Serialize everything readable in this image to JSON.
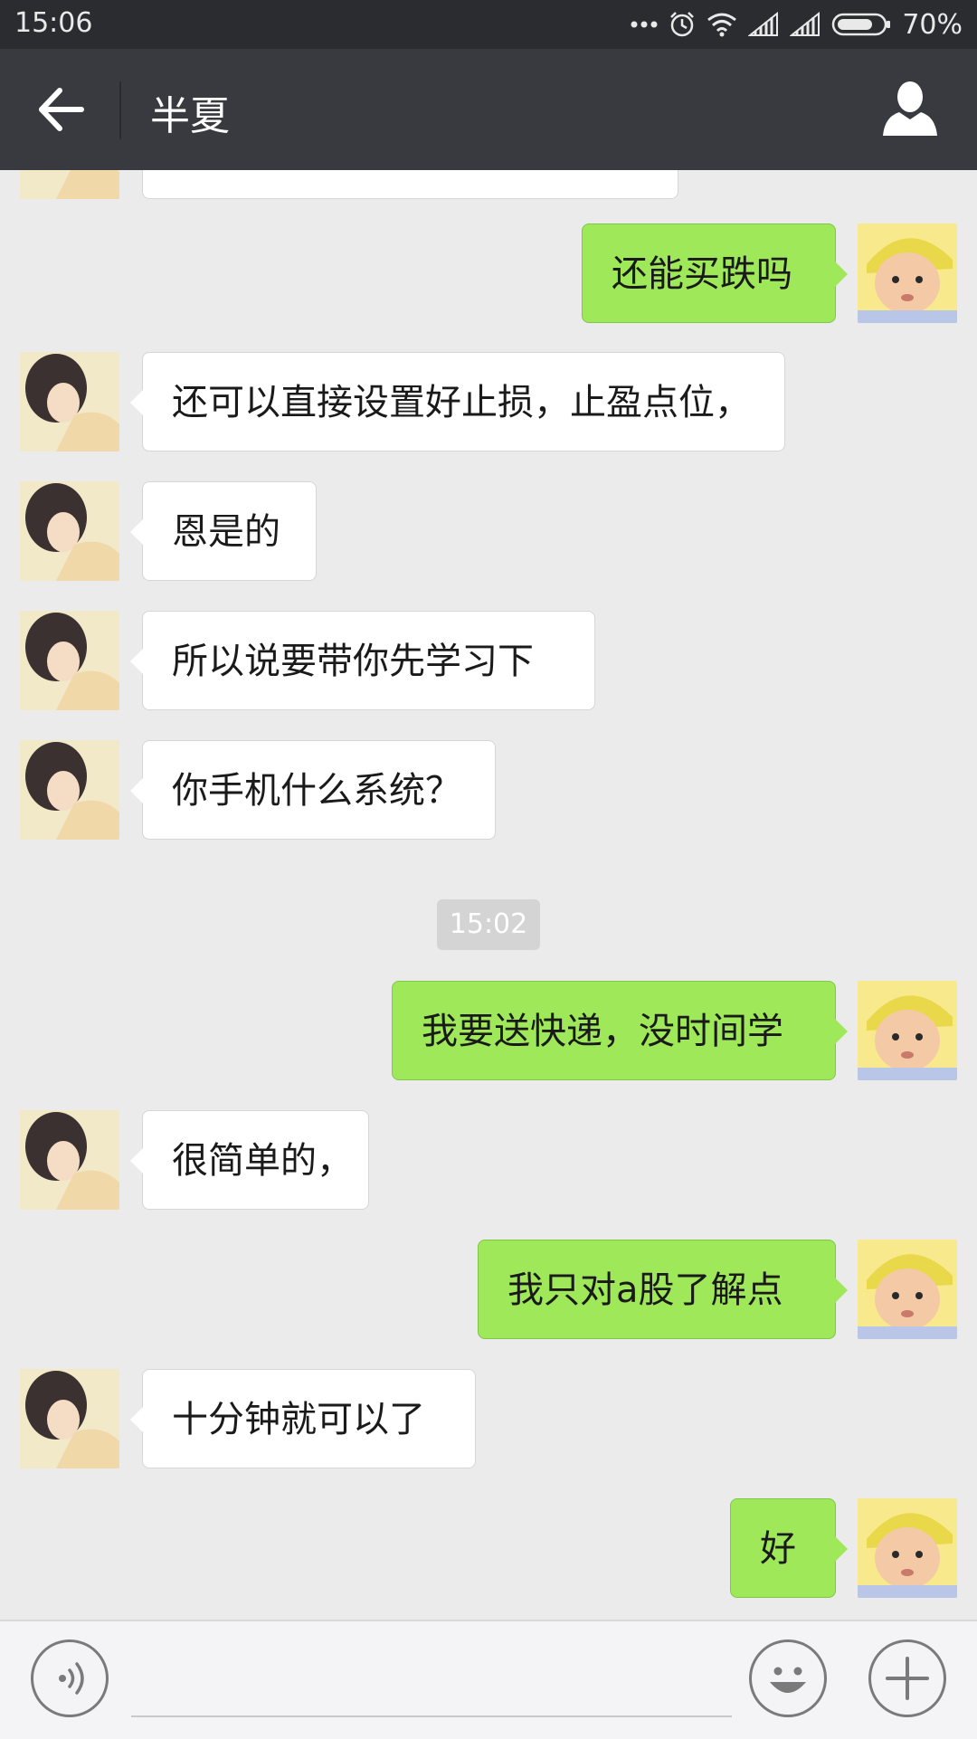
{
  "status_bar": {
    "time": "15:06",
    "battery_percent": "70%",
    "icons": [
      "more-dots-icon",
      "alarm-icon",
      "wifi-icon",
      "signal-icon",
      "signal-icon",
      "battery-icon"
    ]
  },
  "header": {
    "title": "半夏",
    "back_icon": "arrow-left-icon",
    "profile_icon": "person-icon"
  },
  "messages": [
    {
      "side": "left",
      "text": ""
    },
    {
      "side": "right",
      "text": "还能买跌吗"
    },
    {
      "side": "left",
      "text": "还可以直接设置好止损，止盈点位，"
    },
    {
      "side": "left",
      "text": "恩是的"
    },
    {
      "side": "left",
      "text": "所以说要带你先学习下"
    },
    {
      "side": "left",
      "text": "你手机什么系统？"
    },
    {
      "side": "right",
      "text": "我要送快递，没时间学"
    },
    {
      "side": "left",
      "text": "很简单的，"
    },
    {
      "side": "right",
      "text": "我只对a股了解点"
    },
    {
      "side": "left",
      "text": "十分钟就可以了"
    },
    {
      "side": "right",
      "text": "好"
    }
  ],
  "timestamp": "15:02",
  "input_bar": {
    "input_value": "",
    "voice_icon": "voice-icon",
    "emoji_icon": "emoji-icon",
    "plus_icon": "plus-icon"
  },
  "colors": {
    "status_bar_bg": "#2b2c30",
    "title_bar_bg": "#393a3f",
    "chat_bg": "#ebebeb",
    "sent_bubble": "#9ee85a",
    "received_bubble": "#ffffff"
  }
}
